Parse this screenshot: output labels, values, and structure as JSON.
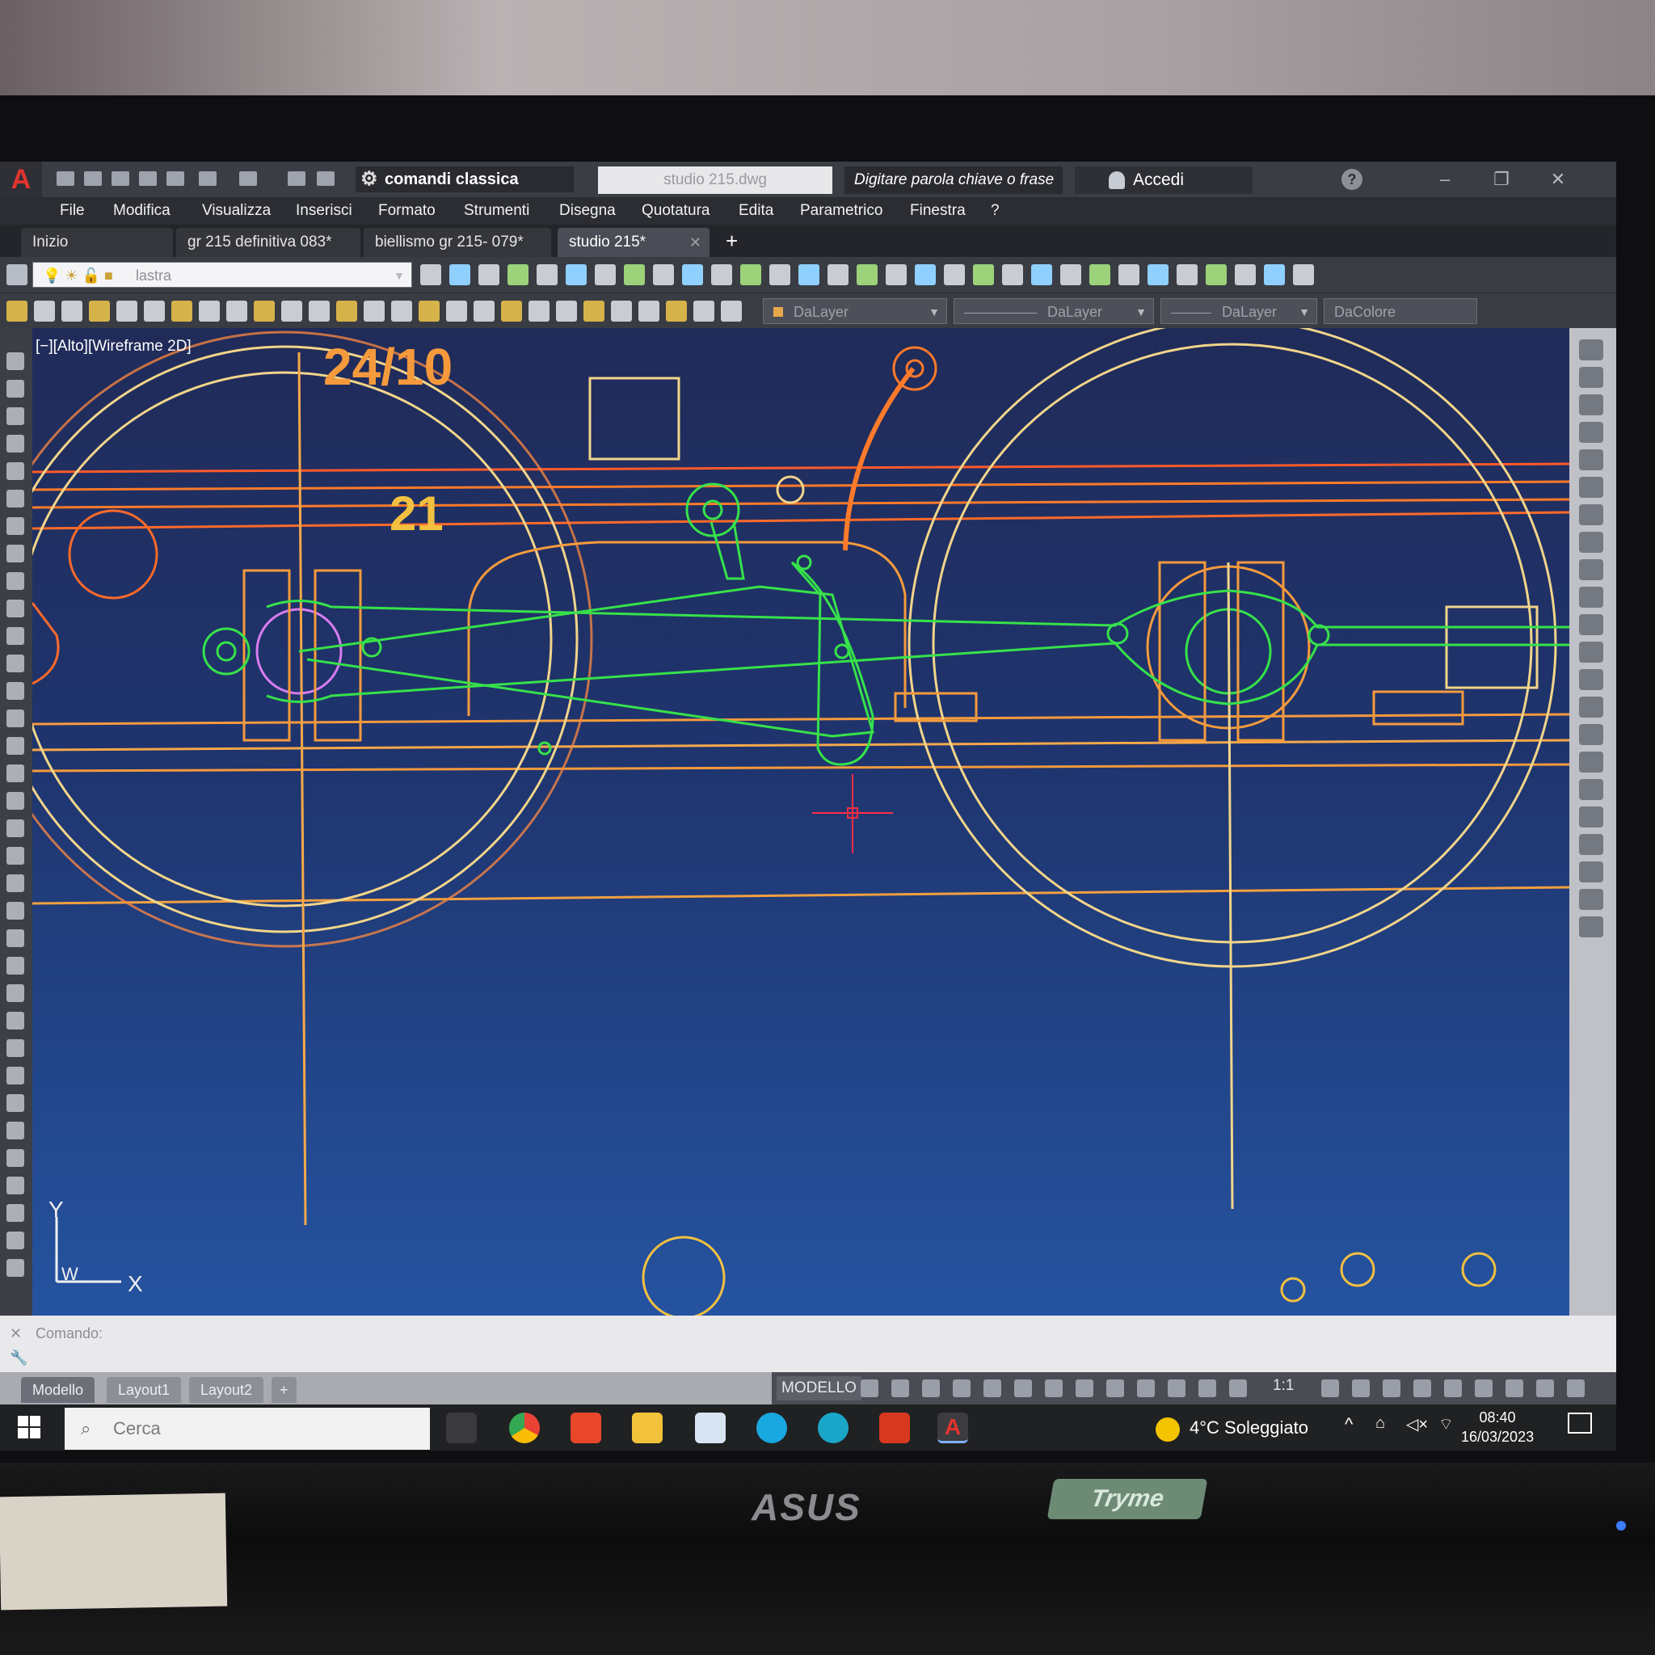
{
  "titlebar": {
    "workspace": "comandi classica",
    "document": "studio 215.dwg",
    "search_placeholder": "Digitare parola chiave o frase",
    "signin": "Accedi",
    "help": "?"
  },
  "menu": [
    "File",
    "Modifica",
    "Visualizza",
    "Inserisci",
    "Formato",
    "Strumenti",
    "Disegna",
    "Quotatura",
    "Edita",
    "Parametrico",
    "Finestra",
    "?"
  ],
  "tabs": [
    {
      "label": "Inizio",
      "active": false
    },
    {
      "label": "gr 215 definitiva 083*",
      "active": false
    },
    {
      "label": "biellismo gr 215- 079*",
      "active": false
    },
    {
      "label": "studio 215*",
      "active": true
    }
  ],
  "toolbar": {
    "layer_name": "lastra",
    "color": "DaLayer",
    "linetype": "DaLayer",
    "lineweight": "DaLayer",
    "plotstyle": "DaColore"
  },
  "viewport": {
    "label": "[−][Alto][Wireframe 2D]",
    "annotation_1": "24/10",
    "annotation_2": "21",
    "ucs_y": "Y",
    "ucs_x": "X",
    "ucs_w": "W"
  },
  "command": {
    "label": "Comando:"
  },
  "layout_tabs": [
    "Modello",
    "Layout1",
    "Layout2"
  ],
  "status": {
    "model": "MODELLO",
    "scale": "1:1"
  },
  "taskbar": {
    "search_placeholder": "Cerca",
    "weather": "4°C  Soleggiato",
    "time": "08:40",
    "date": "16/03/2023"
  },
  "monitor": {
    "brand": "ASUS",
    "sticker": "Tryme"
  },
  "colors": {
    "drawing_orange": "#f59a3c",
    "drawing_red": "#ff5a2a",
    "drawing_green": "#36e24a",
    "drawing_yellow": "#f2d58a",
    "drawing_magenta": "#d97cf0",
    "crosshair": "#ff2b46"
  }
}
